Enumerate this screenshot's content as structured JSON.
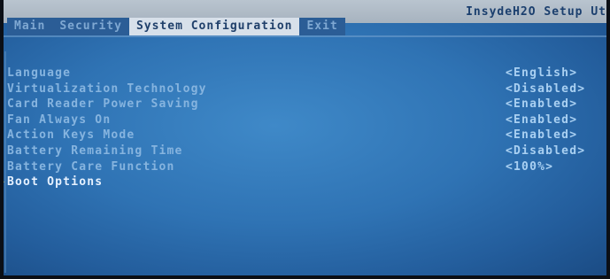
{
  "header": {
    "brand": "InsydeH2O Setup Ut"
  },
  "menu": {
    "tabs": [
      {
        "label": "Main"
      },
      {
        "label": "Security"
      },
      {
        "label": "System Configuration"
      },
      {
        "label": "Exit"
      }
    ],
    "active_tab": "System Configuration"
  },
  "settings": [
    {
      "label": "Language",
      "value": "<English>"
    },
    {
      "label": "Virtualization Technology",
      "value": "<Disabled>"
    },
    {
      "label": "Card Reader Power Saving",
      "value": "<Enabled>"
    },
    {
      "label": "Fan Always On",
      "value": "<Enabled>"
    },
    {
      "label": "Action Keys Mode",
      "value": "<Enabled>"
    },
    {
      "label": "Battery Remaining Time",
      "value": "<Disabled>"
    },
    {
      "label": "Battery Care Function",
      "value": "<100%>"
    }
  ],
  "submenu": {
    "label": "Boot Options",
    "arrow": "▶"
  },
  "colors": {
    "background": "#2f73b4",
    "label": "#86b4df",
    "value": "#a9d0f2",
    "highlight": "#e6f1ff",
    "arrow": "#f4f07a",
    "active_tab": "#d7e0ea"
  }
}
